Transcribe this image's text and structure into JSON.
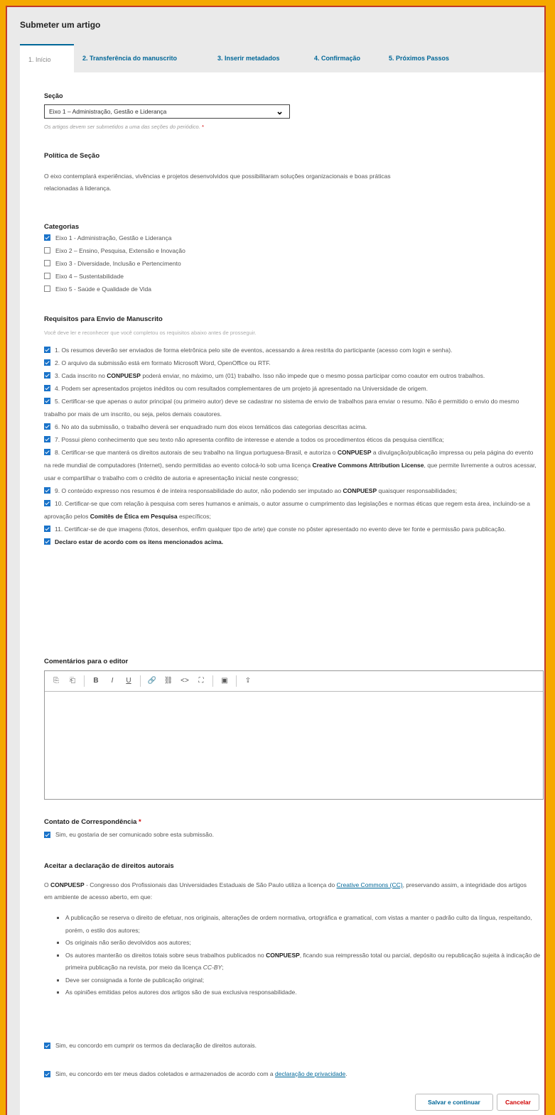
{
  "page": {
    "title": "Submeter um artigo"
  },
  "tabs": [
    {
      "label": "1. Início"
    },
    {
      "label": "2. Transferência do manuscrito"
    },
    {
      "label": "3. Inserir metadados"
    },
    {
      "label": "4. Confirmação"
    },
    {
      "label": "5. Próximos Passos"
    }
  ],
  "section": {
    "label": "Seção",
    "selected": "Eixo 1 – Administração, Gestão e Liderança",
    "help": "Os artigos devem ser submetidos a uma das seções do periódico.",
    "required": "*"
  },
  "policy": {
    "heading": "Política de Seção",
    "line1": "O eixo contemplará experiências, vivências e projetos desenvolvidos que possibilitaram soluções organizacionais e boas práticas",
    "line2": "relacionadas à liderança."
  },
  "categories": {
    "heading": "Categorias",
    "items": [
      {
        "label": "Eixo 1 - Administração, Gestão e Liderança",
        "checked": true
      },
      {
        "label": "Eixo 2 – Ensino, Pesquisa, Extensão e Inovação",
        "checked": false
      },
      {
        "label": "Eixo 3 - Diversidade, Inclusão e Pertencimento",
        "checked": false
      },
      {
        "label": "Eixo 4 – Sustentabilidade",
        "checked": false
      },
      {
        "label": "Eixo 5 - Saúde e Qualidade de Vida",
        "checked": false
      }
    ]
  },
  "requirements": {
    "heading": "Requisitos para Envio de Manuscrito",
    "subtitle": "Você deve ler e reconhecer que você completou os requisitos abaixo antes de prosseguir.",
    "r1": "1. Os resumos deverão ser enviados de forma eletrônica pelo site de eventos, acessando a área restrita do participante (acesso com login e senha).",
    "r2": "2. O arquivo da submissão está em formato Microsoft Word, OpenOffice ou RTF.",
    "r3a": "3. Cada inscrito no ",
    "r3b": "CONPUESP",
    "r3c": " poderá enviar, no máximo, um (01) trabalho. Isso não impede que o mesmo possa participar como coautor em outros trabalhos.",
    "r4": "4. Podem ser apresentados projetos inéditos ou com resultados complementares de um projeto já apresentado na Universidade de origem.",
    "r5": "5. Certificar-se que apenas o autor principal (ou primeiro autor) deve se cadastrar no sistema de envio de trabalhos para enviar o resumo. Não é permitido o envio do mesmo trabalho por mais de um inscrito, ou seja, pelos demais coautores.",
    "r6": "6. No ato da submissão, o trabalho deverá ser enquadrado num dos eixos temáticos das categorias descritas acima.",
    "r7": "7. Possui pleno conhecimento que seu texto não apresenta conflito de interesse e atende a todos os procedimentos éticos da pesquisa científica;",
    "r8a": "8. Certificar-se que manterá os direitos autorais de seu trabalho na língua portuguesa-Brasil, e autoriza o ",
    "r8b": "CONPUESP",
    "r8c": " a divulgação/publicação impressa ou pela página do evento na rede mundial de computadores (Internet), sendo permitidas ao evento colocá-lo sob uma licença ",
    "r8d": "Creative Commons Attribution License",
    "r8e": ", que permite livremente a outros acessar, usar e compartilhar o trabalho com o crédito de autoria e apresentação inicial neste congresso;",
    "r9a": "9. O conteúdo expresso nos resumos é de inteira responsabilidade do autor, não podendo ser imputado ao ",
    "r9b": "CONPUESP",
    "r9c": " quaisquer responsabilidades;",
    "r10a": "10. Certificar-se que com relação à pesquisa com seres humanos e animais, o autor assume o cumprimento das legislações e normas éticas que regem esta área, incluindo-se a aprovação pelos ",
    "r10b": "Comitês de Ética em Pesquisa",
    "r10c": " específicos;",
    "r11": "11. Certificar-se de que imagens (fotos, desenhos, enfim qualquer tipo de arte) que conste no pôster apresentado no evento deve ter fonte e permissão para publicação.",
    "r12": "Declaro estar de acordo com os itens mencionados acima."
  },
  "comments": {
    "heading": "Comentários para o editor"
  },
  "toolbar": {
    "copy": "⎘",
    "paste": "⎗",
    "bold": "B",
    "italic": "I",
    "underline": "U",
    "link": "🔗",
    "unlink": "⛓",
    "code": "<>",
    "fullscreen": "⛶",
    "image": "▣",
    "upload": "⇪"
  },
  "contact": {
    "heading": "Contato de Correspondência",
    "required": "*",
    "option": "Sim, eu gostaria de ser comunicado sobre esta submissão."
  },
  "copyright": {
    "heading": "Aceitar a declaração de direitos autorais",
    "p_a": "O ",
    "p_b": "CONPUESP",
    "p_c": " - Congresso dos Profissionais das Universidades Estaduais  de São Paulo utiliza a licença do ",
    "p_link": "Creative Commons (CC)",
    "p_d": ", preservando assim, a integridade dos artigos em ambiente de acesso aberto, em que:",
    "li1": "A publicação se reserva o direito de efetuar, nos originais, alterações de ordem normativa, ortográfica e gramatical, com vistas a manter o padrão culto da língua, respeitando, porém, o estilo dos autores;",
    "li2": "Os originais não serão devolvidos aos autores;",
    "li3a": "Os autores manterão os direitos totais sobre seus trabalhos publicados no ",
    "li3b": "CONPUESP",
    "li3c": ", ficando sua reimpressão total ou parcial, depósito ou republicação sujeita à indicação de primeira publicação na revista, por meio da licença ",
    "li3d": "CC-BY",
    "li3e": ";",
    "li4": "Deve ser consignada a fonte de publicação original;",
    "li5": "As opiniões emitidas pelos autores dos artigos são de sua exclusiva responsabilidade."
  },
  "agree": {
    "terms": "Sim, eu concordo em cumprir os termos da declaração de direitos autorais.",
    "privacy_a": "Sim, eu concordo em ter meus dados coletados e armazenados de acordo com a ",
    "privacy_link": "declaração de privacidade",
    "privacy_b": "."
  },
  "buttons": {
    "save": "Salvar e continuar",
    "cancel": "Cancelar"
  },
  "colors": {
    "accent": "#006798",
    "cancel": "#d00000",
    "border": "#f5a800",
    "checkbox": "#1a73c9"
  }
}
